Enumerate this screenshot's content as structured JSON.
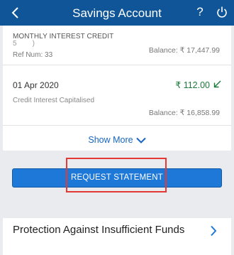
{
  "header": {
    "title": "Savings Account",
    "help_glyph": "?",
    "icons": [
      "back-icon",
      "help-icon",
      "power-icon"
    ]
  },
  "transactions": [
    {
      "label": "MONTHLY INTEREST CREDIT",
      "sub": "5           )",
      "ref": "Ref Num: 33",
      "balance": "Balance: ₹ 17,447.99"
    },
    {
      "date": "01 Apr 2020",
      "amount": "₹ 112.00",
      "description": "Credit Interest Capitalised",
      "balance": "Balance: ₹ 16,858.99"
    }
  ],
  "show_more": "Show More",
  "request_statement": "REQUEST STATEMENT",
  "protection": "Protection Against Insufficient Funds",
  "colors": {
    "header": "#0f5597",
    "credit_green": "#1a7a3a",
    "link_blue": "#1565c0",
    "button_blue": "#1e78d7",
    "highlight_red": "#e53935"
  }
}
